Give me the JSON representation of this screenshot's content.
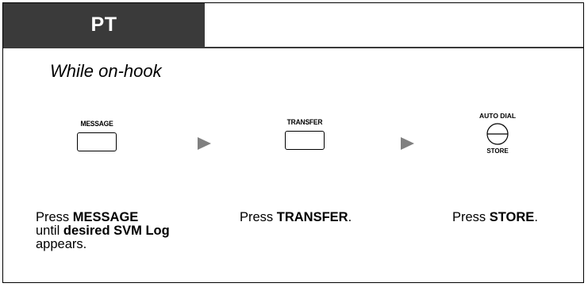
{
  "header": {
    "title": "PT"
  },
  "condition": "While on-hook",
  "keys": {
    "message": "MESSAGE",
    "transfer": "TRANSFER",
    "autodial_top": "AUTO DIAL",
    "autodial_bottom": "STORE"
  },
  "steps": [
    {
      "prefix": "Press ",
      "bold1": "MESSAGE",
      "line2_prefix": "until ",
      "bold2": "desired SVM Log",
      "line3": "appears."
    },
    {
      "prefix": "Press ",
      "bold1": "TRANSFER",
      "suffix": "."
    },
    {
      "prefix": "Press ",
      "bold1": "STORE",
      "suffix": "."
    }
  ],
  "colors": {
    "header_bg": "#3a3a3a",
    "arrow": "#808080"
  }
}
